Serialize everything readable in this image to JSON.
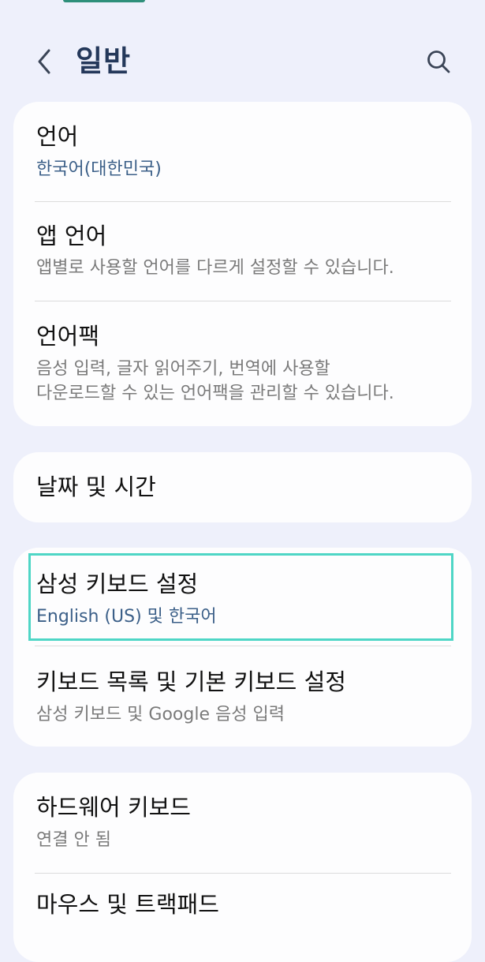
{
  "header": {
    "title": "일반"
  },
  "sections": [
    {
      "items": [
        {
          "title": "언어",
          "subtitle": "한국어(대한민국)"
        },
        {
          "title": "앱 언어",
          "subtitle": "앱별로 사용할 언어를 다르게 설정할 수 있습니다."
        },
        {
          "title": "언어팩",
          "subtitle": "음성 입력, 글자 읽어주기, 번역에 사용할\n다운로드할 수 있는 언어팩을 관리할 수 있습니다."
        }
      ]
    },
    {
      "items": [
        {
          "title": "날짜 및 시간"
        }
      ]
    },
    {
      "items": [
        {
          "title": "삼성 키보드 설정",
          "subtitle": "English (US) 및 한국어"
        },
        {
          "title": "키보드 목록 및 기본 키보드 설정",
          "subtitle": "삼성 키보드 및 Google 음성 입력"
        }
      ]
    },
    {
      "items": [
        {
          "title": "하드웨어 키보드",
          "subtitle": "연결 안 됨"
        },
        {
          "title": "마우스 및 트랙패드"
        }
      ]
    }
  ],
  "colors": {
    "background": "#eef0fb",
    "title": "#24385a",
    "accent_subtitle": "#3b5f88",
    "highlight": "#4fd6c6"
  },
  "icons": {
    "back": "chevron-left-icon",
    "search": "search-icon"
  }
}
